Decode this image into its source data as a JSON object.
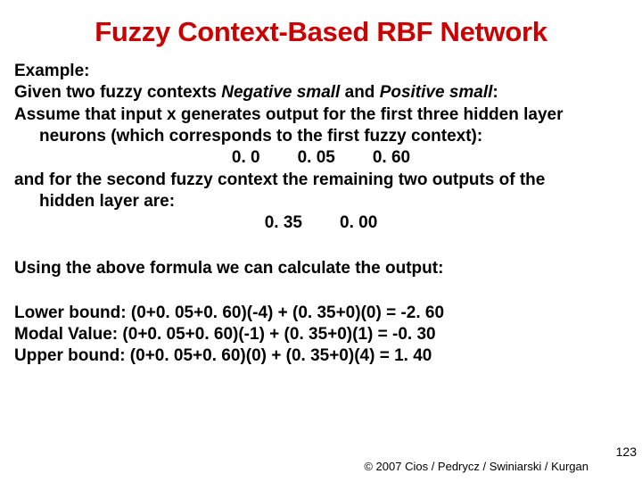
{
  "title": "Fuzzy Context-Based RBF Network",
  "example_label": "Example:",
  "given_prefix": "Given two fuzzy contexts ",
  "context1": "Negative small",
  "given_and": " and ",
  "context2": "Positive small",
  "given_suffix": ":",
  "assume_line1": "Assume that input x generates output for the first three hidden layer",
  "assume_line2": "neurons (which corresponds to the first fuzzy context):",
  "vals1_a": "0. 0",
  "vals1_b": "0. 05",
  "vals1_c": "0. 60",
  "second_line1": "and for the second fuzzy context the remaining two outputs of the",
  "second_line2": "hidden layer are:",
  "vals2_a": "0. 35",
  "vals2_b": "0. 00",
  "using_line": "Using the above formula we can calculate the output:",
  "lower_label": "Lower bound:",
  "lower_expr": " (0+0. 05+0. 60)(-4) + (0. 35+0)(0) = -2. 60",
  "modal_label": "Modal Value:",
  "modal_expr": "  (0+0. 05+0. 60)(-1) + (0. 35+0)(1) = -0. 30",
  "upper_label": "Upper bound:",
  "upper_expr": " (0+0. 05+0. 60)(0) + (0. 35+0)(4) = 1. 40",
  "footer": "© 2007 Cios / Pedrycz / Swiniarski / Kurgan",
  "page_number": "123"
}
